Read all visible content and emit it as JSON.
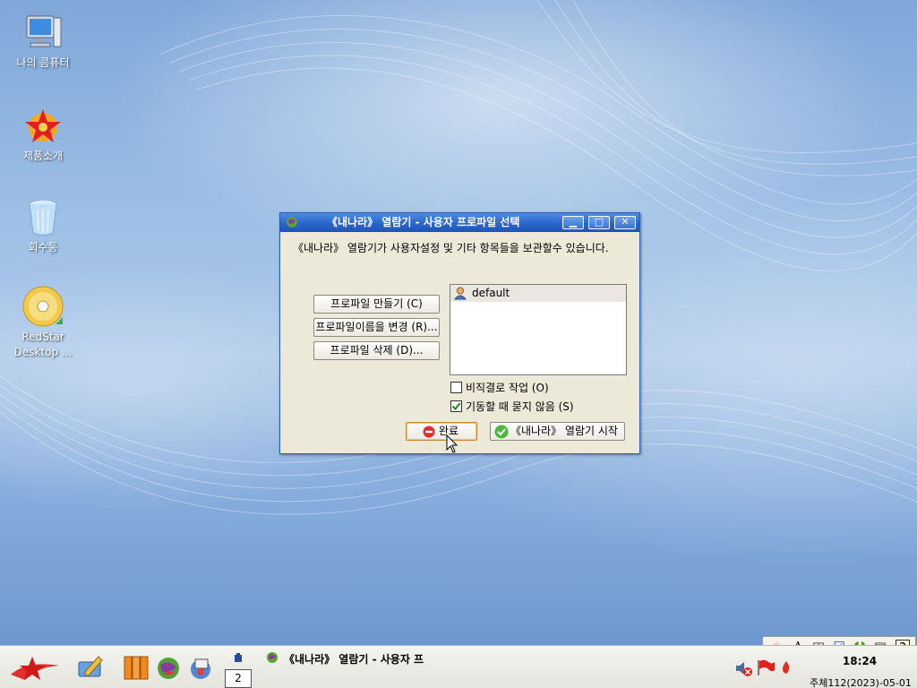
{
  "desktop": {
    "icons": [
      {
        "label": "나의 콤퓨터",
        "icon": "computer-icon"
      },
      {
        "label": "제품소개",
        "icon": "redstar-product-icon"
      },
      {
        "label": "회수통",
        "icon": "trash-icon"
      },
      {
        "label": "RedStar Desktop ...",
        "icon": "cd-icon"
      }
    ]
  },
  "dialog": {
    "title": "《내나라》 열람기 - 사용자 프로파일 선택",
    "intro_text": "《내나라》 열람기가 사용자설정 및 기타 항목들을 보관할수 있습니다.",
    "buttons": {
      "create_profile": "프로파일 만들기 (C)",
      "rename_profile": "프로파일이름을 변경 (R)...",
      "delete_profile": "프로파일 삭제 (D)...",
      "exit": "완료",
      "start": "《내나라》 열람기 시작"
    },
    "profiles": [
      "default"
    ],
    "work_offline": {
      "label": "비직결로 작업 (O)",
      "checked": false
    },
    "dont_ask": {
      "label": "기동할 때 묻지 않음 (S)",
      "checked": true
    }
  },
  "taskbar": {
    "active_task": "《내나라》 열람기 - 사용자 프",
    "workspace_number": "2",
    "clock_time": "18:24",
    "clock_date": "주체112(2023)-05-01"
  },
  "colors": {
    "titlebar": "#2b66cc",
    "dialog_bg": "#ece9d8",
    "desktop": "#88aedd"
  }
}
